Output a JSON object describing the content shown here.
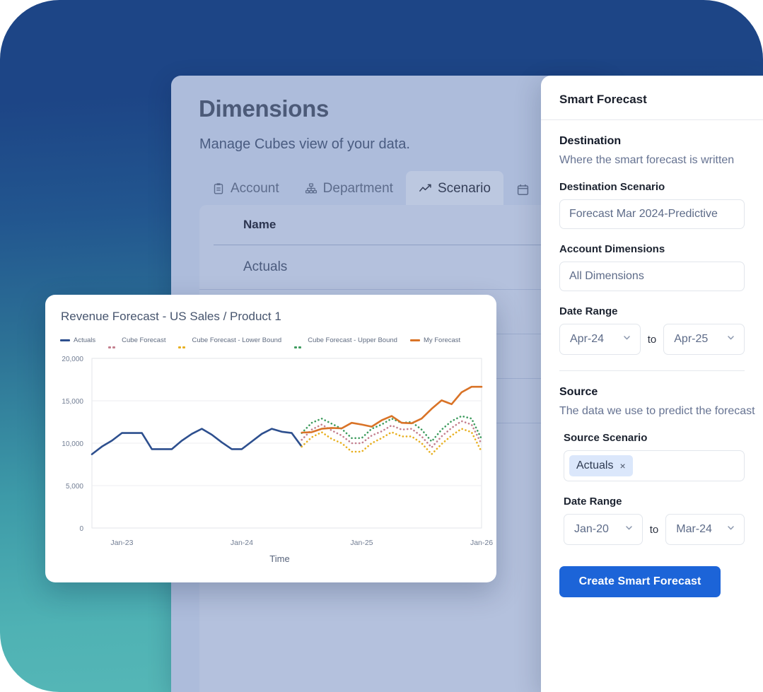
{
  "background": {
    "top_color": "#1d4586",
    "bottom_color": "#57b8b7"
  },
  "dimensions_panel": {
    "title": "Dimensions",
    "subtitle": "Manage Cubes view of your data.",
    "tabs": [
      {
        "label": "Account",
        "icon": "clipboard-icon",
        "active": false
      },
      {
        "label": "Department",
        "icon": "org-chart-icon",
        "active": false
      },
      {
        "label": "Scenario",
        "icon": "line-chart-icon",
        "active": true
      },
      {
        "label": "",
        "icon": "calendar-icon",
        "active": false
      }
    ],
    "table": {
      "columns": [
        "Name"
      ],
      "rows": [
        [
          "Actuals"
        ]
      ]
    }
  },
  "forecast_panel": {
    "title": "Smart Forecast",
    "destination": {
      "heading": "Destination",
      "description": "Where the smart forecast is written",
      "scenario_label": "Destination Scenario",
      "scenario_value": "Forecast Mar 2024-Predictive",
      "dimensions_label": "Account Dimensions",
      "dimensions_value": "All Dimensions",
      "date_range_label": "Date Range",
      "date_from": "Apr-24",
      "date_to_label": "to",
      "date_to": "Apr-25"
    },
    "source": {
      "heading": "Source",
      "description": "The data we use to predict the forecast",
      "scenario_label": "Source Scenario",
      "chips": [
        {
          "label": "Actuals",
          "remove": "×"
        }
      ],
      "date_range_label": "Date Range",
      "date_from": "Jan-20",
      "date_to_label": "to",
      "date_to": "Mar-24"
    },
    "submit_label": "Create Smart Forecast",
    "accent_color": "#1c64d8"
  },
  "chart_data": {
    "type": "line",
    "title": "Revenue Forecast - US Sales / Product 1",
    "xlabel": "Time",
    "ylabel": "",
    "ylim": [
      0,
      20000
    ],
    "yticks": [
      0,
      5000,
      10000,
      15000,
      20000
    ],
    "ytick_labels": [
      "0",
      "5,000",
      "10,000",
      "15,000",
      "20,000"
    ],
    "xtick_labels": [
      "Jan-23",
      "Jan-24",
      "Jan-25",
      "Jan-26"
    ],
    "xtick_positions": [
      3,
      15,
      27,
      39
    ],
    "grid": true,
    "legend_position": "top",
    "x": [
      0,
      1,
      2,
      3,
      4,
      5,
      6,
      7,
      8,
      9,
      10,
      11,
      12,
      13,
      14,
      15,
      16,
      17,
      18,
      19,
      20,
      21,
      22,
      23,
      24,
      25,
      26,
      27,
      28,
      29,
      30,
      31,
      32,
      33,
      34,
      35,
      36,
      37,
      38,
      39
    ],
    "series": [
      {
        "name": "Actuals",
        "color": "#2d4f8e",
        "style": "solid",
        "x": [
          0,
          1,
          2,
          3,
          4,
          5,
          6,
          7,
          8,
          9,
          10,
          11,
          12,
          13,
          14,
          15,
          16,
          17,
          18,
          19,
          20,
          21
        ],
        "values": [
          8700,
          9600,
          10300,
          11200,
          11200,
          11200,
          9300,
          9300,
          9300,
          10300,
          11100,
          11700,
          11000,
          10100,
          9300,
          9300,
          10200,
          11100,
          11700,
          11350,
          11200,
          9600
        ]
      },
      {
        "name": "Cube Forecast",
        "color": "#c4808f",
        "style": "dotted",
        "x": [
          21,
          22,
          23,
          24,
          25,
          26,
          27,
          28,
          29,
          30,
          31,
          32,
          33,
          34,
          35,
          36,
          37,
          38,
          39
        ],
        "values": [
          10400,
          11600,
          12200,
          11500,
          10900,
          10000,
          10000,
          10900,
          11400,
          12100,
          11600,
          11700,
          10800,
          9500,
          10800,
          11800,
          12600,
          12200,
          9900
        ]
      },
      {
        "name": "Cube Forecast - Lower Bound",
        "color": "#e8b021",
        "style": "dotted",
        "x": [
          21,
          22,
          23,
          24,
          25,
          26,
          27,
          28,
          29,
          30,
          31,
          32,
          33,
          34,
          35,
          36,
          37,
          38,
          39
        ],
        "values": [
          9600,
          10700,
          11300,
          10500,
          10000,
          9000,
          9000,
          10000,
          10600,
          11300,
          10800,
          10800,
          10000,
          8700,
          9900,
          10900,
          11700,
          11300,
          9000
        ]
      },
      {
        "name": "Cube Forecast - Upper Bound",
        "color": "#3f9c5f",
        "style": "dotted",
        "x": [
          21,
          22,
          23,
          24,
          25,
          26,
          27,
          28,
          29,
          30,
          31,
          32,
          33,
          34,
          35,
          36,
          37,
          38,
          39
        ],
        "values": [
          11200,
          12400,
          12900,
          12300,
          11700,
          10600,
          10600,
          11700,
          12200,
          12900,
          12400,
          12500,
          11600,
          10200,
          11600,
          12600,
          13200,
          12900,
          10500
        ]
      },
      {
        "name": "My Forecast",
        "color": "#d97327",
        "style": "solid",
        "x": [
          21,
          22,
          23,
          24,
          25,
          26,
          27,
          28,
          29,
          30,
          31,
          32,
          33,
          34,
          35,
          36,
          37,
          38,
          39
        ],
        "values": [
          11250,
          11300,
          11700,
          11800,
          11750,
          12400,
          12200,
          11950,
          12700,
          13200,
          12400,
          12350,
          12900,
          14050,
          15050,
          14600,
          16000,
          16650,
          16650
        ]
      }
    ]
  }
}
